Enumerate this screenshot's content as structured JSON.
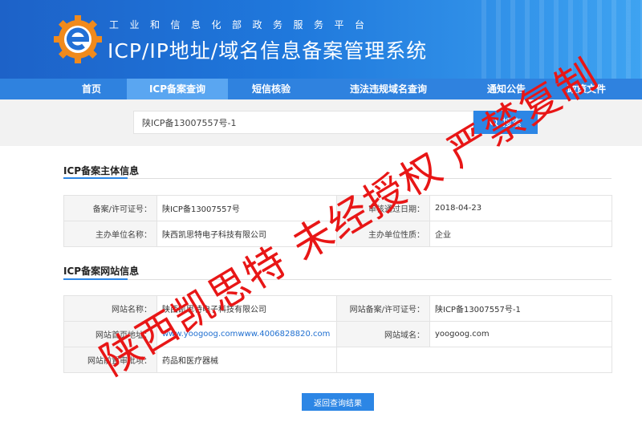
{
  "header": {
    "subtitle": "工业和信息化部政务服务平台",
    "title": "ICP/IP地址/域名信息备案管理系统",
    "logo_icon": "gear-e-logo-icon"
  },
  "nav": {
    "items": [
      {
        "label": "首页"
      },
      {
        "label": "ICP备案查询"
      },
      {
        "label": "短信核验"
      },
      {
        "label": "违法违规域名查询"
      },
      {
        "label": "通知公告"
      },
      {
        "label": "政策文件"
      }
    ],
    "active_index": 1
  },
  "search": {
    "value": "陕ICP备13007557号-1",
    "button_label": "搜索",
    "button_icon": "search-icon"
  },
  "subject_section": {
    "title": "ICP备案主体信息",
    "rows": [
      {
        "label1": "备案/许可证号：",
        "value1": "陕ICP备13007557号",
        "label2": "审核通过日期：",
        "value2": "2018-04-23"
      },
      {
        "label1": "主办单位名称：",
        "value1": "陕西凯思特电子科技有限公司",
        "label2": "主办单位性质：",
        "value2": "企业"
      }
    ]
  },
  "website_section": {
    "title": "ICP备案网站信息",
    "rows": [
      {
        "label1": "网站名称：",
        "value1": "陕西凯思特电子科技有限公司",
        "label2": "网站备案/许可证号：",
        "value2": "陕ICP备13007557号-1"
      },
      {
        "label1": "网站首页地址：",
        "value1": "www.yoogoog.comwww.4006828820.com",
        "label2": "网站域名：",
        "value2": "yoogoog.com"
      },
      {
        "label1": "网站前置审批项：",
        "value1": "药品和医疗器械",
        "label2": "",
        "value2": ""
      }
    ]
  },
  "back_button_label": "返回查询结果",
  "watermark": "陕西凯思特  未经授权  严禁复制",
  "colors": {
    "header_blue": "#1f78dc",
    "nav_blue": "#2f82df",
    "nav_active": "#5aa6f1",
    "button_blue": "#2c86e5",
    "watermark_red": "#e81616"
  }
}
